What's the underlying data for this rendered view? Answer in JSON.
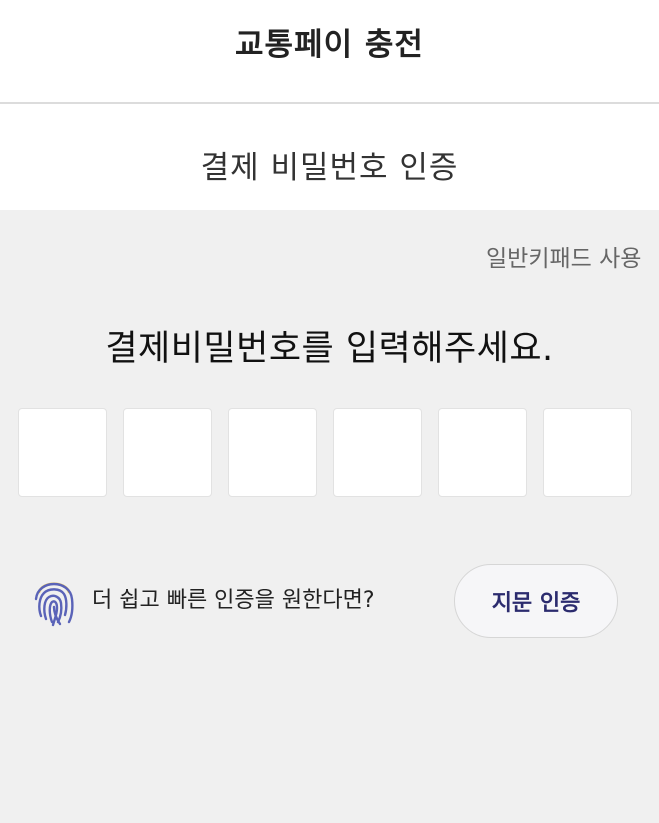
{
  "header": {
    "title": "교통페이 충전"
  },
  "subheader": {
    "title": "결제 비밀번호 인증"
  },
  "keypad_toggle": {
    "label": "일반키패드 사용"
  },
  "prompt": {
    "text": "결제비밀번호를 입력해주세요."
  },
  "pin": {
    "length": 6,
    "entered": 0
  },
  "biometric": {
    "icon": "fingerprint-icon",
    "text": "더 쉽고 빠른 인증을 원한다면?",
    "button_label": "지문 인증"
  },
  "colors": {
    "background": "#f0f0f0",
    "accent": "#2b2b6e",
    "fingerprint_blue": "#5a63b8",
    "fingerprint_yellow": "#f2c94c"
  }
}
